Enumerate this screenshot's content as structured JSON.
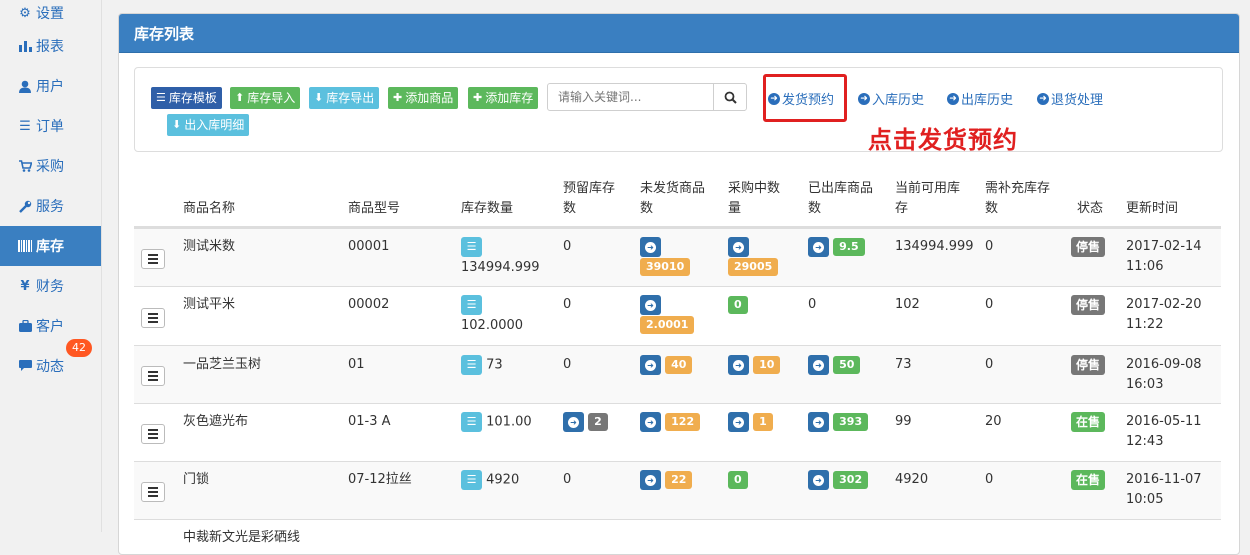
{
  "sidebar": {
    "items": [
      {
        "label": "设置",
        "icon": "gear-icon",
        "glyph": "⚙"
      },
      {
        "label": "报表",
        "icon": "bar-chart-icon",
        "glyph": "▮"
      },
      {
        "label": "用户",
        "icon": "user-icon",
        "glyph": "●"
      },
      {
        "label": "订单",
        "icon": "list-icon",
        "glyph": "☰"
      },
      {
        "label": "采购",
        "icon": "cart-icon",
        "glyph": "⛟"
      },
      {
        "label": "服务",
        "icon": "wrench-icon",
        "glyph": "✎"
      },
      {
        "label": "库存",
        "icon": "barcode-icon",
        "glyph": "‖",
        "active": true
      },
      {
        "label": "财务",
        "icon": "yen-icon",
        "glyph": "¥"
      },
      {
        "label": "客户",
        "icon": "briefcase-icon",
        "glyph": "▣"
      },
      {
        "label": "动态",
        "icon": "comment-icon",
        "glyph": "▤",
        "badge": "42"
      }
    ]
  },
  "panel": {
    "title": "库存列表"
  },
  "toolbar": {
    "buttons": {
      "template": "库存模板",
      "import": "库存导入",
      "export": "库存导出",
      "add_product": "添加商品",
      "add_stock": "添加库存",
      "inout_detail": "出入库明细"
    },
    "search_placeholder": "请输入关键词...",
    "links": {
      "ship_reserve": "发货预约",
      "in_history": "入库历史",
      "out_history": "出库历史",
      "returns": "退货处理"
    },
    "annotation": "点击发货预约"
  },
  "colors": {
    "accent": "#3a7fc1",
    "annotation": "#e02020"
  },
  "table": {
    "headers": {
      "name": "商品名称",
      "model": "商品型号",
      "stock": "库存数量",
      "reserved_1": "预留库存",
      "reserved_2": "数",
      "unshipped_1": "未发货商品",
      "unshipped_2": "数",
      "purchasing_1": "采购中数",
      "purchasing_2": "量",
      "shipped_1": "已出库商品",
      "shipped_2": "数",
      "available_1": "当前可用库",
      "available_2": "存",
      "need_1": "需补充库存",
      "need_2": "数",
      "status": "状态",
      "updated": "更新时间"
    },
    "rows": [
      {
        "name": "测试米数",
        "model": "00001",
        "stock": "134994.999",
        "reserved": "0",
        "unshipped": "39010",
        "purchasing": "29005",
        "shipped": "9.5",
        "available": "134994.999",
        "need": "0",
        "status": "停售",
        "date": "2017-02-14",
        "time": "11:06"
      },
      {
        "name": "测试平米",
        "model": "00002",
        "stock": "102.0000",
        "reserved": "0",
        "unshipped": "2.0001",
        "purchasing": "0",
        "shipped": "0",
        "available": "102",
        "need": "0",
        "status": "停售",
        "date": "2017-02-20",
        "time": "11:22"
      },
      {
        "name": "一品芝兰玉树",
        "model": "01",
        "stock": "73",
        "reserved": "0",
        "unshipped": "40",
        "purchasing": "10",
        "shipped": "50",
        "available": "73",
        "need": "0",
        "status": "停售",
        "date": "2016-09-08",
        "time": "16:03"
      },
      {
        "name": "灰色遮光布",
        "model": "01-3 A",
        "stock": "101.00",
        "reserved": "2",
        "unshipped": "122",
        "purchasing": "1",
        "shipped": "393",
        "available": "99",
        "need": "20",
        "status": "在售",
        "date": "2016-05-11",
        "time": "12:43"
      },
      {
        "name": "门锁",
        "model": "07-12拉丝",
        "stock": "4920",
        "reserved": "0",
        "unshipped": "22",
        "purchasing": "0",
        "shipped": "302",
        "available": "4920",
        "need": "0",
        "status": "在售",
        "date": "2016-11-07",
        "time": "10:05"
      },
      {
        "name": "中裁新文光是彩硒线",
        "model": "",
        "stock": "",
        "reserved": "",
        "unshipped": "",
        "purchasing": "",
        "shipped": "",
        "available": "",
        "need": "",
        "status": "",
        "date": "",
        "time": ""
      }
    ]
  }
}
